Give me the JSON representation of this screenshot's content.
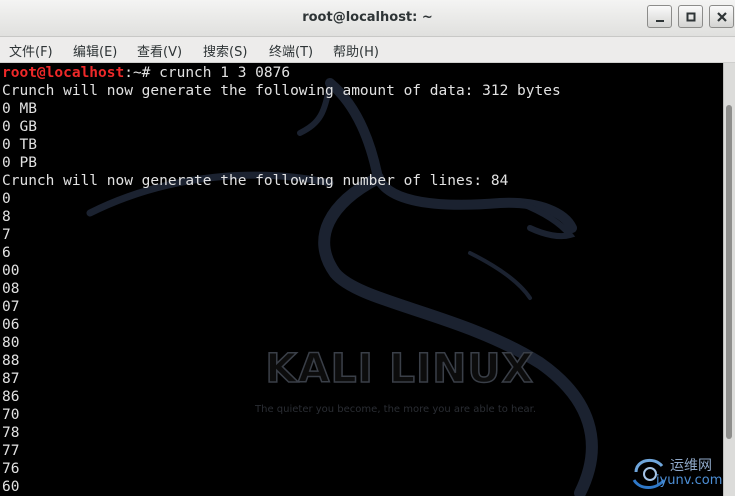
{
  "window": {
    "title": "root@localhost: ~"
  },
  "menubar": {
    "items": [
      "文件(F)",
      "编辑(E)",
      "查看(V)",
      "搜索(S)",
      "终端(T)",
      "帮助(H)"
    ]
  },
  "terminal": {
    "prompt": {
      "user_host": "root@localhost",
      "separator": ":~# ",
      "command": "crunch 1 3 0876"
    },
    "output_lines": [
      "Crunch will now generate the following amount of data: 312 bytes",
      "0 MB",
      "0 GB",
      "0 TB",
      "0 PB",
      "Crunch will now generate the following number of lines: 84",
      "0",
      "8",
      "7",
      "6",
      "00",
      "08",
      "07",
      "06",
      "80",
      "88",
      "87",
      "86",
      "70",
      "78",
      "77",
      "76",
      "60"
    ],
    "background": {
      "brand": "KALI LINUX",
      "tagline": "The quieter you become, the more you are able to hear."
    }
  },
  "watermark": {
    "cn_text": "运维网",
    "url": "iyunv.com"
  },
  "colors": {
    "terminal_bg": "#000000",
    "terminal_fg": "#e2e2e2",
    "prompt_user": "#ef2929",
    "titlebar": "#ebebea"
  }
}
